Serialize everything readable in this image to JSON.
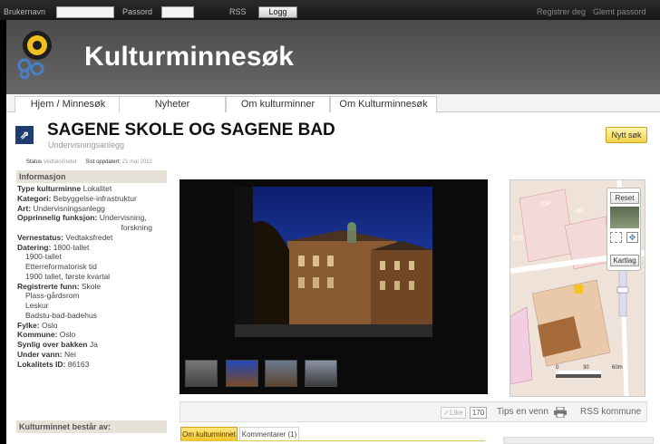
{
  "topbar": {
    "username_label": "Brukernavn",
    "password_label": "Passord",
    "rss_label": "RSS",
    "login_label": "Logg inn",
    "register_link": "Registrer deg",
    "forgot_link": "Glemt passord"
  },
  "header": {
    "site_title": "Kulturminnesøk"
  },
  "nav": {
    "tabs": [
      {
        "label": "Hjem / Minnesøk"
      },
      {
        "label": "Nyheter"
      },
      {
        "label": "Om kulturminner"
      },
      {
        "label": "Om Kulturminnesøk"
      }
    ]
  },
  "page": {
    "title": "SAGENE SKOLE OG SAGENE BAD",
    "subtitle": "Undervisningsanlegg",
    "new_search_label": "Nytt søk",
    "status_label": "Status",
    "status_value": "Vedtaksfredet",
    "updated_label": "Sist oppdatert:",
    "updated_value": "21 mai 2012"
  },
  "info": {
    "heading": "Informasjon",
    "type_label": "Type kulturminne",
    "type_value": "Lokalitet",
    "category_label": "Kategori:",
    "category_value": "Bebyggelse-infrastruktur",
    "art_label": "Art:",
    "art_value": "Undervisningsanlegg",
    "function_label": "Opprinnelig funksjon:",
    "function_value": "Undervisning,",
    "function_value_2": "forskning",
    "protection_label": "Vernestatus:",
    "protection_value": "Vedtaksfredet",
    "dating_label": "Datering:",
    "dating_value": "1800-tallet",
    "dating_sub": [
      "1900-tallet",
      "Etterreformatorisk tid",
      "1900 tallet, første kvartal"
    ],
    "finds_label": "Registrerte funn:",
    "finds_value": "Skole",
    "finds_sub": [
      "Plass-gårdsrom",
      "Leskur",
      "Badstu-bad-badehus"
    ],
    "county_label": "Fylke:",
    "county_value": "Oslo",
    "municipality_label": "Kommune:",
    "municipality_value": "Oslo",
    "visible_label": "Synlig over bakken",
    "visible_value": "Ja",
    "underwater_label": "Under vann:",
    "underwater_value": "Nei",
    "locality_label": "Lokalitets ID:",
    "locality_value": "86163",
    "consists_heading": "Kulturminnet består av:"
  },
  "map": {
    "reset_label": "Reset",
    "map_layers_label": "Kartlag",
    "labels": [
      "10P",
      "8B",
      "10T"
    ],
    "scale": [
      "0",
      "30",
      "60m"
    ]
  },
  "actions": {
    "like_label": "Like",
    "like_count": "170",
    "tips_label": "Tips en venn",
    "rss_label": "RSS kommune"
  },
  "bottom_tabs": {
    "about_label": "Om kulturminnet",
    "comments_label": "Kommentarer (1)"
  },
  "colors": {
    "header_bg": "#555555",
    "accent_yellow": "#f2c522",
    "page_icon_bg": "#1f3d6e",
    "section_bg": "#e6e2d8"
  }
}
